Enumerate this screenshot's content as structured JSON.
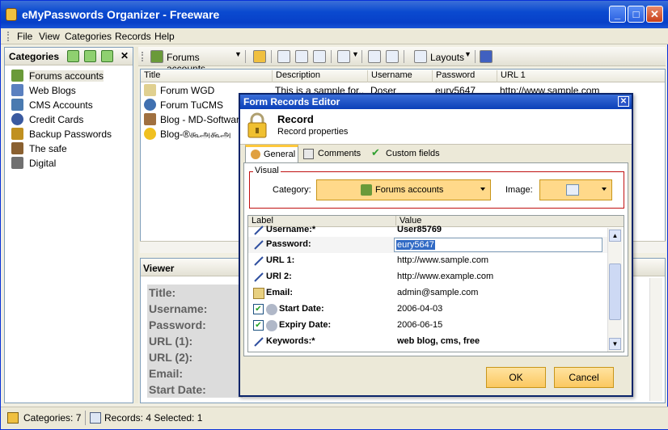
{
  "app": {
    "title": "eMyPasswords Organizer - Freeware",
    "window_buttons": {
      "minimize": "_",
      "maximize": "□",
      "close": "✕"
    }
  },
  "menu": [
    "File",
    "View",
    "Categories",
    "Records",
    "Help"
  ],
  "categories": {
    "title": "Categories",
    "close": "✕",
    "items": [
      {
        "label": "Forums accounts",
        "icon": "users-icon",
        "color": "#6a9a3a"
      },
      {
        "label": "Web Blogs",
        "icon": "document-icon",
        "color": "#5a80c0"
      },
      {
        "label": "CMS Accounts",
        "icon": "monitor-icon",
        "color": "#4a7ab0"
      },
      {
        "label": "Credit Cards",
        "icon": "globe-icon",
        "color": "#3a5aa0"
      },
      {
        "label": "Backup Passwords",
        "icon": "padlock-icon",
        "color": "#c09020"
      },
      {
        "label": "The safe",
        "icon": "person-icon",
        "color": "#8a6030"
      },
      {
        "label": "Digital",
        "icon": "camera-icon",
        "color": "#707070"
      }
    ]
  },
  "toolbar": {
    "forums_dropdown": "Forums accounts",
    "layouts": "Layouts"
  },
  "grid": {
    "headers": [
      "Title",
      "Description",
      "Username",
      "Password",
      "URL 1"
    ],
    "rows": [
      {
        "title": "Forum WGD",
        "description": "This is a sample for...",
        "username": "Doser",
        "password": "eury5647",
        "url": "http://www.sample.com",
        "icon_color": "#e0d090"
      },
      {
        "title": "Forum TuCMS",
        "description": "",
        "username": "",
        "password": "",
        "url": "",
        "icon_color": "#4070b0"
      },
      {
        "title": "Blog - MD-Software",
        "description": "",
        "username": "",
        "password": "",
        "url": "",
        "icon_color": "#a07040"
      },
      {
        "title": "Blog-®கூஅகூஅ",
        "description": "",
        "username": "",
        "password": "",
        "url": "",
        "icon_color": "#f0c020"
      }
    ]
  },
  "viewer": {
    "title": "Viewer",
    "fields": [
      "Title:",
      "Username:",
      "Password:",
      "URL (1):",
      "URL (2):",
      "Email:",
      "Start Date:"
    ]
  },
  "status": {
    "categories": "Categories: 7",
    "records": "Records: 4 Selected: 1"
  },
  "dialog": {
    "title": "Form Records Editor",
    "close": "✕",
    "heading": "Record",
    "subheading": "Record properties",
    "tabs": [
      "General",
      "Comments",
      "Custom fields"
    ],
    "visual_legend": "Visual",
    "category_label": "Category:",
    "category_value": "Forums accounts",
    "image_label": "Image:",
    "table_headers": {
      "label": "Label",
      "value": "Value"
    },
    "properties": [
      {
        "label": "Username:*",
        "value": "User85769",
        "icon": "pen-icon"
      },
      {
        "label": "Password:",
        "value": "eury5647",
        "icon": "pen-icon"
      },
      {
        "label": "URL 1:",
        "value": "http://www.sample.com",
        "icon": "pen-icon"
      },
      {
        "label": "URl 2:",
        "value": "http://www.example.com",
        "icon": "pen-icon"
      },
      {
        "label": "Email:",
        "value": "admin@sample.com",
        "icon": "folder-icon"
      },
      {
        "label": "Start Date:",
        "value": "2006-04-03",
        "icon": "calendar-icon"
      },
      {
        "label": "Expiry Date:",
        "value": "2006-06-15",
        "icon": "calendar-icon"
      },
      {
        "label": "Keywords:*",
        "value": "web blog, cms, free",
        "icon": "pen-icon"
      }
    ],
    "ok": "OK",
    "cancel": "Cancel"
  }
}
